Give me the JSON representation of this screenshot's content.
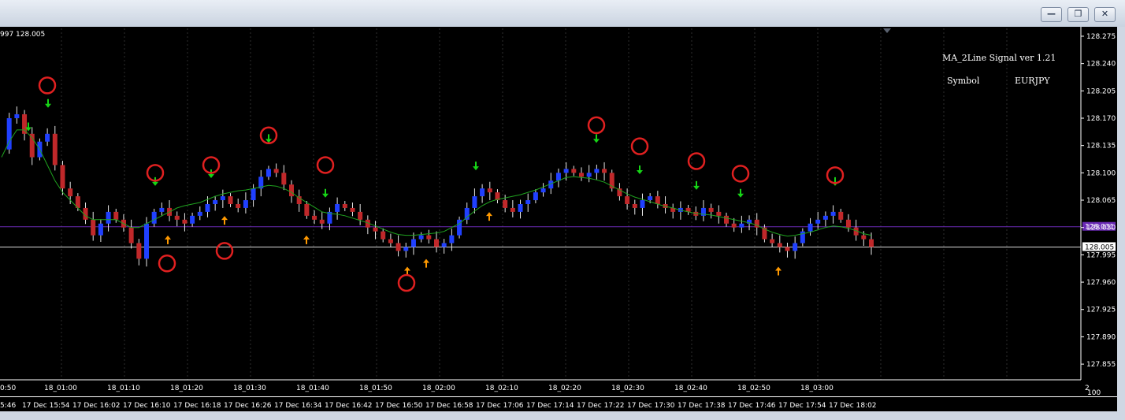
{
  "window": {
    "minimize_icon": "minimize-icon",
    "restore_icon": "restore-icon",
    "close_icon": "close-icon"
  },
  "chart": {
    "corner_info": "997 128.005",
    "indicator_name": "MA_2Line Signal ver 1.21",
    "symbol_label": "Symbol",
    "symbol_value": "EURJPY",
    "current_price_label": "128.005",
    "purple_level_label": "128.031",
    "scale_tail_1": "2",
    "scale_tail_2": "100",
    "colors": {
      "background": "#000000",
      "bull_candle": "#2040ff",
      "bear_candle": "#c0282a",
      "ma_line": "#1fa31f",
      "buy_arrow": "#ff9900",
      "sell_arrow": "#16d416",
      "signal_circle": "#e02020",
      "level_line": "#6a2ab5"
    }
  },
  "chart_data": {
    "type": "candlestick",
    "symbol": "EURJPY",
    "y_ticks": [
      "128.275",
      "128.240",
      "128.205",
      "128.170",
      "128.135",
      "128.100",
      "128.065",
      "128.030",
      "127.995",
      "127.960",
      "127.925",
      "127.890",
      "127.855"
    ],
    "ylim": [
      127.845,
      128.279
    ],
    "current_price": 128.005,
    "purple_level": 128.031,
    "x_ticks_top": [
      "0:50",
      "18_01:00",
      "18_01:10",
      "18_01:20",
      "18_01:30",
      "18_01:40",
      "18_01:50",
      "18_02:00",
      "18_02:10",
      "18_02:20",
      "18_02:30",
      "18_02:40",
      "18_02:50",
      "18_03:00"
    ],
    "x_ticks_bottom": [
      "5:46",
      "17 Dec 15:54",
      "17 Dec 16:02",
      "17 Dec 16:10",
      "17 Dec 16:18",
      "17 Dec 16:26",
      "17 Dec 16:34",
      "17 Dec 16:42",
      "17 Dec 16:50",
      "17 Dec 16:58",
      "17 Dec 17:06",
      "17 Dec 17:14",
      "17 Dec 17:22",
      "17 Dec 17:30",
      "17 Dec 17:38",
      "17 Dec 17:46",
      "17 Dec 17:54",
      "17 Dec 18:02"
    ],
    "close_path": [
      128.13,
      128.17,
      128.175,
      128.15,
      128.12,
      128.14,
      128.15,
      128.11,
      128.08,
      128.07,
      128.055,
      128.04,
      128.02,
      128.035,
      128.05,
      128.04,
      128.03,
      128.01,
      127.99,
      128.035,
      128.05,
      128.055,
      128.045,
      128.04,
      128.035,
      128.045,
      128.05,
      128.06,
      128.065,
      128.07,
      128.06,
      128.055,
      128.065,
      128.08,
      128.095,
      128.105,
      128.1,
      128.085,
      128.07,
      128.06,
      128.045,
      128.04,
      128.035,
      128.05,
      128.06,
      128.055,
      128.05,
      128.04,
      128.03,
      128.025,
      128.015,
      128.01,
      128.0,
      128.005,
      128.015,
      128.02,
      128.015,
      128.005,
      128.01,
      128.02,
      128.04,
      128.055,
      128.07,
      128.08,
      128.075,
      128.065,
      128.055,
      128.05,
      128.06,
      128.065,
      128.075,
      128.08,
      128.09,
      128.1,
      128.105,
      128.1,
      128.095,
      128.1,
      128.105,
      128.1,
      128.08,
      128.07,
      128.06,
      128.055,
      128.065,
      128.07,
      128.06,
      128.055,
      128.05,
      128.055,
      128.05,
      128.045,
      128.055,
      128.05,
      128.045,
      128.035,
      128.03,
      128.035,
      128.04,
      128.03,
      128.015,
      128.01,
      128.005,
      128.0,
      128.01,
      128.025,
      128.035,
      128.04,
      128.045,
      128.05,
      128.04,
      128.03,
      128.02,
      128.015,
      128.005
    ],
    "ma_path": [
      128.12,
      128.14,
      128.155,
      128.155,
      128.145,
      128.13,
      128.11,
      128.09,
      128.075,
      128.065,
      128.055,
      128.045,
      128.04,
      128.04,
      128.04,
      128.04,
      128.035,
      128.03,
      128.03,
      128.035,
      128.04,
      128.045,
      128.05,
      128.055,
      128.058,
      128.06,
      128.062,
      128.066,
      128.07,
      128.073,
      128.075,
      128.077,
      128.078,
      128.08,
      128.082,
      128.084,
      128.083,
      128.08,
      128.075,
      128.068,
      128.062,
      128.056,
      128.05,
      128.048,
      128.047,
      128.045,
      128.042,
      128.039,
      128.036,
      128.032,
      128.028,
      128.024,
      128.021,
      128.02,
      128.02,
      128.021,
      128.022,
      128.023,
      128.025,
      128.03,
      128.035,
      128.043,
      128.051,
      128.058,
      128.063,
      128.066,
      128.068,
      128.07,
      128.072,
      128.075,
      128.078,
      128.082,
      128.086,
      128.09,
      128.094,
      128.095,
      128.094,
      128.093,
      128.091,
      128.088,
      128.083,
      128.078,
      128.073,
      128.069,
      128.066,
      128.063,
      128.06,
      128.057,
      128.055,
      128.052,
      128.05,
      128.048,
      128.047,
      128.046,
      128.044,
      128.042,
      128.04,
      128.038,
      128.036,
      128.033,
      128.028,
      128.024,
      128.021,
      128.019,
      128.02,
      128.022,
      128.024,
      128.027,
      128.03,
      128.032,
      128.031,
      128.029,
      128.026,
      128.022,
      128.02
    ],
    "sell_arrows": [
      36,
      61,
      197,
      268,
      341,
      413,
      604,
      757,
      812,
      884,
      940,
      1060
    ],
    "buy_arrows": [
      213,
      285,
      389,
      517,
      541,
      621,
      988
    ],
    "circles": [
      {
        "x": 60,
        "price": 128.212
      },
      {
        "x": 197,
        "price": 128.1
      },
      {
        "x": 268,
        "price": 128.11
      },
      {
        "x": 341,
        "price": 128.148
      },
      {
        "x": 413,
        "price": 128.11
      },
      {
        "x": 757,
        "price": 128.161
      },
      {
        "x": 812,
        "price": 128.134
      },
      {
        "x": 884,
        "price": 128.115
      },
      {
        "x": 940,
        "price": 128.099
      },
      {
        "x": 1060,
        "price": 128.097
      },
      {
        "x": 212,
        "price": 127.984
      },
      {
        "x": 285,
        "price": 128.0
      },
      {
        "x": 516,
        "price": 127.959
      }
    ]
  }
}
